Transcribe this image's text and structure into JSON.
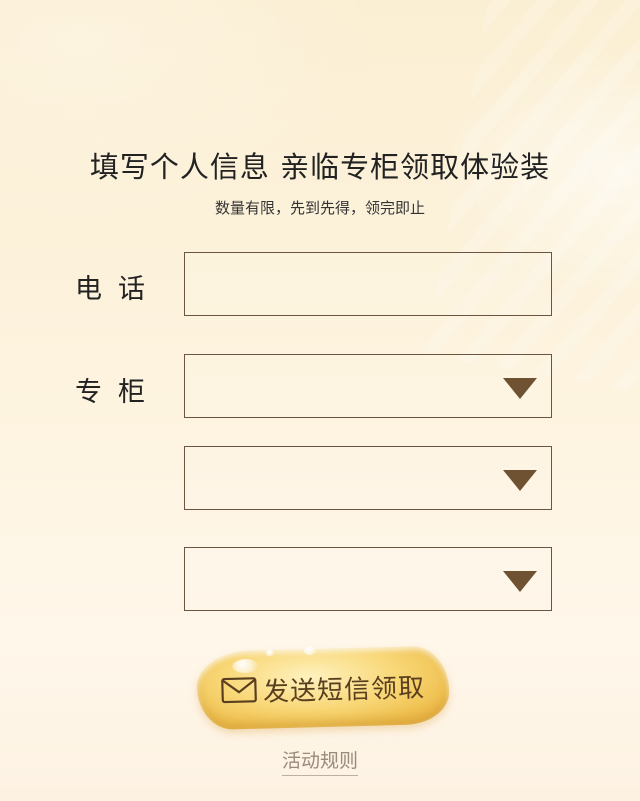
{
  "header": {
    "title": "填写个人信息 亲临专柜领取体验装",
    "subtitle": "数量有限，先到先得，领完即止"
  },
  "form": {
    "phone_label": "电话",
    "phone_value": "",
    "counter_label": "专柜",
    "select_1_value": "",
    "select_2_value": "",
    "select_3_value": ""
  },
  "actions": {
    "send_label": "发送短信领取",
    "send_icon": "mail-icon",
    "rules_label": "活动规则"
  },
  "colors": {
    "caret": "#6e5232",
    "border": "#6b5440",
    "button_gold": "#f8d776"
  }
}
